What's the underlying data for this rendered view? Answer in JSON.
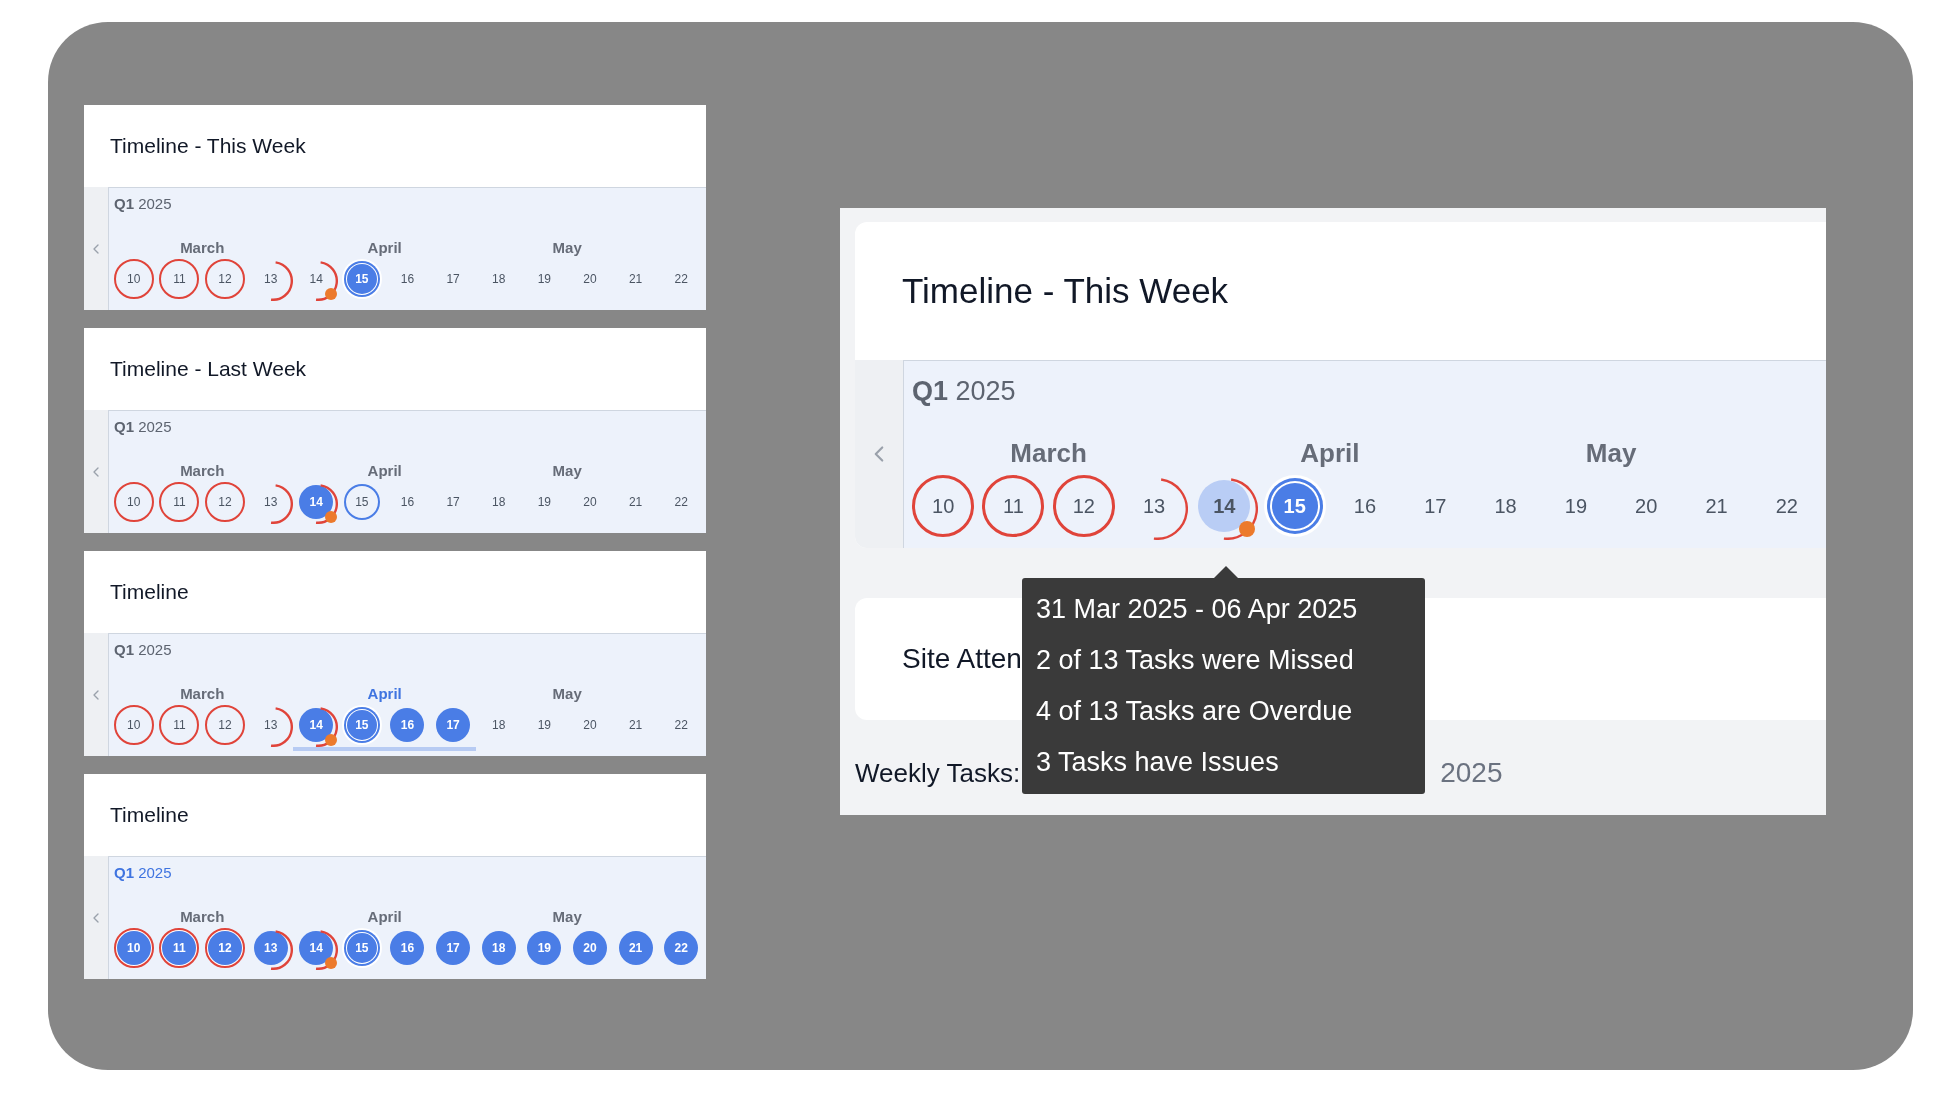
{
  "cards": [
    {
      "title": "Timeline - This Week",
      "timeline": {
        "quarter": {
          "label": "**Q1** 2025",
          "selected": false
        },
        "months": [
          {
            "label": "March",
            "selected": false
          },
          {
            "label": "April",
            "selected": false
          },
          {
            "label": "May",
            "selected": false
          }
        ],
        "days": [
          {
            "label": "10",
            "kind": "missed",
            "filled": false,
            "hovered": false,
            "selected": false
          },
          {
            "label": "11",
            "kind": "missed",
            "filled": false,
            "hovered": false,
            "selected": false
          },
          {
            "label": "12",
            "kind": "missed",
            "filled": false,
            "hovered": false,
            "selected": false
          },
          {
            "label": "13",
            "kind": "late",
            "filled": false,
            "hovered": false,
            "selected": false
          },
          {
            "label": "14",
            "kind": "issue",
            "filled": false,
            "hovered": false,
            "selected": false
          },
          {
            "label": "15",
            "kind": "current",
            "filled": true,
            "hovered": false,
            "selected": false
          },
          {
            "label": "16",
            "kind": "plain",
            "filled": false,
            "hovered": false,
            "selected": false
          },
          {
            "label": "17",
            "kind": "plain",
            "filled": false,
            "hovered": false,
            "selected": false
          },
          {
            "label": "18",
            "kind": "plain",
            "filled": false,
            "hovered": false,
            "selected": false
          },
          {
            "label": "19",
            "kind": "plain",
            "filled": false,
            "hovered": false,
            "selected": false
          },
          {
            "label": "20",
            "kind": "plain",
            "filled": false,
            "hovered": false,
            "selected": false
          },
          {
            "label": "21",
            "kind": "plain",
            "filled": false,
            "hovered": false,
            "selected": false
          },
          {
            "label": "22",
            "kind": "plain",
            "filled": false,
            "hovered": false,
            "selected": false
          }
        ]
      }
    },
    {
      "title": "Timeline - Last Week",
      "timeline": {
        "quarter": {
          "label": "**Q1** 2025",
          "selected": false
        },
        "months": [
          {
            "label": "March",
            "selected": false
          },
          {
            "label": "April",
            "selected": false
          },
          {
            "label": "May",
            "selected": false
          }
        ],
        "days": [
          {
            "label": "10",
            "kind": "missed",
            "filled": false,
            "hovered": false,
            "selected": false
          },
          {
            "label": "11",
            "kind": "missed",
            "filled": false,
            "hovered": false,
            "selected": false
          },
          {
            "label": "12",
            "kind": "missed",
            "filled": false,
            "hovered": false,
            "selected": false
          },
          {
            "label": "13",
            "kind": "late",
            "filled": false,
            "hovered": false,
            "selected": false
          },
          {
            "label": "14",
            "kind": "issue",
            "filled": true,
            "hovered": false,
            "selected": false
          },
          {
            "label": "15",
            "kind": "outlined",
            "filled": false,
            "hovered": false,
            "selected": false
          },
          {
            "label": "16",
            "kind": "plain",
            "filled": false,
            "hovered": false,
            "selected": false
          },
          {
            "label": "17",
            "kind": "plain",
            "filled": false,
            "hovered": false,
            "selected": false
          },
          {
            "label": "18",
            "kind": "plain",
            "filled": false,
            "hovered": false,
            "selected": false
          },
          {
            "label": "19",
            "kind": "plain",
            "filled": false,
            "hovered": false,
            "selected": false
          },
          {
            "label": "20",
            "kind": "plain",
            "filled": false,
            "hovered": false,
            "selected": false
          },
          {
            "label": "21",
            "kind": "plain",
            "filled": false,
            "hovered": false,
            "selected": false
          },
          {
            "label": "22",
            "kind": "plain",
            "filled": false,
            "hovered": false,
            "selected": false
          }
        ]
      }
    },
    {
      "title": "Timeline",
      "timeline": {
        "quarter": {
          "label": "**Q1** 2025",
          "selected": false
        },
        "months": [
          {
            "label": "March",
            "selected": false
          },
          {
            "label": "April",
            "selected": true
          },
          {
            "label": "May",
            "selected": false
          }
        ],
        "days": [
          {
            "label": "10",
            "kind": "missed",
            "filled": false,
            "hovered": false,
            "selected": false
          },
          {
            "label": "11",
            "kind": "missed",
            "filled": false,
            "hovered": false,
            "selected": false
          },
          {
            "label": "12",
            "kind": "missed",
            "filled": false,
            "hovered": false,
            "selected": false
          },
          {
            "label": "13",
            "kind": "late",
            "filled": false,
            "hovered": false,
            "selected": false
          },
          {
            "label": "14",
            "kind": "issue",
            "filled": true,
            "hovered": false,
            "selected": true
          },
          {
            "label": "15",
            "kind": "current",
            "filled": true,
            "hovered": false,
            "selected": true
          },
          {
            "label": "16",
            "kind": "plain",
            "filled": true,
            "hovered": false,
            "selected": true
          },
          {
            "label": "17",
            "kind": "plain",
            "filled": true,
            "hovered": false,
            "selected": true
          },
          {
            "label": "18",
            "kind": "plain",
            "filled": false,
            "hovered": false,
            "selected": false
          },
          {
            "label": "19",
            "kind": "plain",
            "filled": false,
            "hovered": false,
            "selected": false
          },
          {
            "label": "20",
            "kind": "plain",
            "filled": false,
            "hovered": false,
            "selected": false
          },
          {
            "label": "21",
            "kind": "plain",
            "filled": false,
            "hovered": false,
            "selected": false
          },
          {
            "label": "22",
            "kind": "plain",
            "filled": false,
            "hovered": false,
            "selected": false
          }
        ]
      }
    },
    {
      "title": "Timeline",
      "timeline": {
        "quarter": {
          "label": "**Q1** 2025",
          "selected": true
        },
        "months": [
          {
            "label": "March",
            "selected": false
          },
          {
            "label": "April",
            "selected": false
          },
          {
            "label": "May",
            "selected": false
          }
        ],
        "days": [
          {
            "label": "10",
            "kind": "missed",
            "filled": true,
            "hovered": false,
            "selected": false
          },
          {
            "label": "11",
            "kind": "missed",
            "filled": true,
            "hovered": false,
            "selected": false
          },
          {
            "label": "12",
            "kind": "missed",
            "filled": true,
            "hovered": false,
            "selected": false
          },
          {
            "label": "13",
            "kind": "late",
            "filled": true,
            "hovered": false,
            "selected": false
          },
          {
            "label": "14",
            "kind": "issue",
            "filled": true,
            "hovered": false,
            "selected": false
          },
          {
            "label": "15",
            "kind": "current",
            "filled": true,
            "hovered": false,
            "selected": false
          },
          {
            "label": "16",
            "kind": "plain",
            "filled": true,
            "hovered": false,
            "selected": false
          },
          {
            "label": "17",
            "kind": "plain",
            "filled": true,
            "hovered": false,
            "selected": false
          },
          {
            "label": "18",
            "kind": "plain",
            "filled": true,
            "hovered": false,
            "selected": false
          },
          {
            "label": "19",
            "kind": "plain",
            "filled": true,
            "hovered": false,
            "selected": false
          },
          {
            "label": "20",
            "kind": "plain",
            "filled": true,
            "hovered": false,
            "selected": false
          },
          {
            "label": "21",
            "kind": "plain",
            "filled": true,
            "hovered": false,
            "selected": false
          },
          {
            "label": "22",
            "kind": "plain",
            "filled": true,
            "hovered": false,
            "selected": false
          }
        ]
      }
    }
  ],
  "detail": {
    "title": "Timeline - This Week",
    "timeline": {
      "quarter": {
        "label": "**Q1** 2025",
        "selected": false
      },
      "months": [
        {
          "label": "March",
          "selected": false
        },
        {
          "label": "April",
          "selected": false
        },
        {
          "label": "May",
          "selected": false
        }
      ],
      "days": [
        {
          "label": "10",
          "kind": "missed",
          "filled": false,
          "hovered": false,
          "selected": false
        },
        {
          "label": "11",
          "kind": "missed",
          "filled": false,
          "hovered": false,
          "selected": false
        },
        {
          "label": "12",
          "kind": "missed",
          "filled": false,
          "hovered": false,
          "selected": false
        },
        {
          "label": "13",
          "kind": "late",
          "filled": false,
          "hovered": false,
          "selected": false
        },
        {
          "label": "14",
          "kind": "issue",
          "filled": false,
          "hovered": true,
          "selected": false
        },
        {
          "label": "15",
          "kind": "current",
          "filled": true,
          "hovered": false,
          "selected": false
        },
        {
          "label": "16",
          "kind": "plain",
          "filled": false,
          "hovered": false,
          "selected": false
        },
        {
          "label": "17",
          "kind": "plain",
          "filled": false,
          "hovered": false,
          "selected": false
        },
        {
          "label": "18",
          "kind": "plain",
          "filled": false,
          "hovered": false,
          "selected": false
        },
        {
          "label": "19",
          "kind": "plain",
          "filled": false,
          "hovered": false,
          "selected": false
        },
        {
          "label": "20",
          "kind": "plain",
          "filled": false,
          "hovered": false,
          "selected": false
        },
        {
          "label": "21",
          "kind": "plain",
          "filled": false,
          "hovered": false,
          "selected": false
        },
        {
          "label": "22",
          "kind": "plain",
          "filled": false,
          "hovered": false,
          "selected": false
        }
      ]
    },
    "tooltip": {
      "lines": [
        "31 Mar 2025 - 06 Apr 2025",
        "2 of 13 Tasks were Missed",
        "4 of 13 Tasks are Overdue",
        "3 Tasks have Issues"
      ]
    },
    "attendance": {
      "title": "Site Atten"
    },
    "weekly": {
      "label": "Weekly Tasks:",
      "deadline": "2025"
    }
  }
}
